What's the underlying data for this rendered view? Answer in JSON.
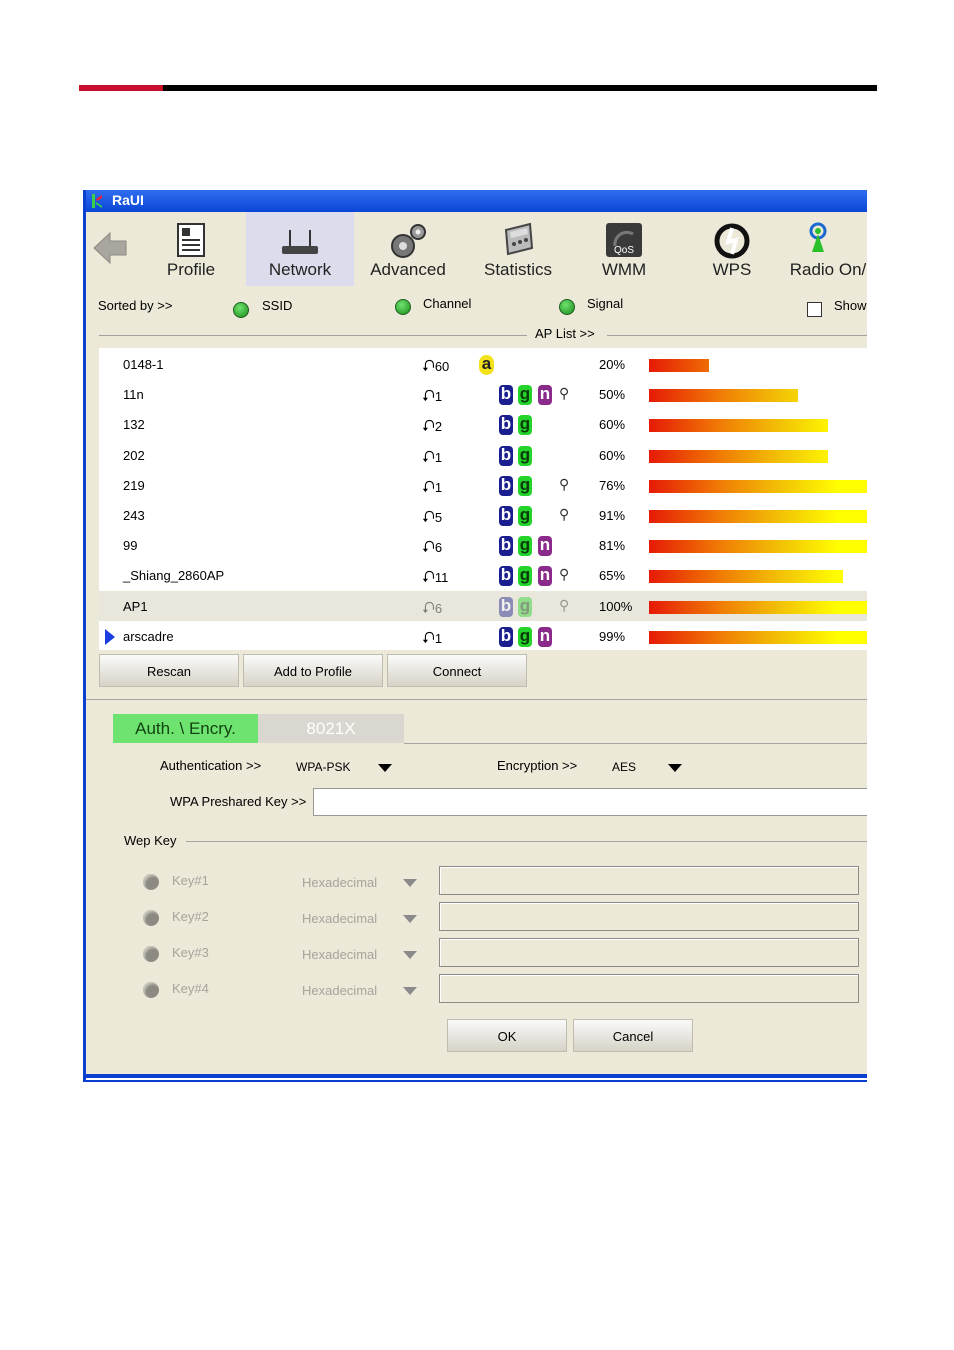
{
  "app": {
    "title": "RaUI"
  },
  "toolbar": {
    "items": [
      {
        "label": "Profile"
      },
      {
        "label": "Network"
      },
      {
        "label": "Advanced"
      },
      {
        "label": "Statistics"
      },
      {
        "label": "WMM"
      },
      {
        "label": "WPS"
      },
      {
        "label": "Radio On/"
      }
    ],
    "active": "Network"
  },
  "sort": {
    "label": "Sorted by >>",
    "options": [
      "SSID",
      "Channel",
      "Signal"
    ],
    "show_label": "Show"
  },
  "aplist": {
    "label": "AP List >>",
    "rows": [
      {
        "ssid": "0148-1",
        "channel": "60",
        "modes": [
          "a"
        ],
        "secured": false,
        "signal": "20%",
        "signal_value": 20
      },
      {
        "ssid": "11n",
        "channel": "1",
        "modes": [
          "b",
          "g",
          "n"
        ],
        "secured": true,
        "signal": "50%",
        "signal_value": 50
      },
      {
        "ssid": "132",
        "channel": "2",
        "modes": [
          "b",
          "g"
        ],
        "secured": false,
        "signal": "60%",
        "signal_value": 60
      },
      {
        "ssid": "202",
        "channel": "1",
        "modes": [
          "b",
          "g"
        ],
        "secured": false,
        "signal": "60%",
        "signal_value": 60
      },
      {
        "ssid": "219",
        "channel": "1",
        "modes": [
          "b",
          "g"
        ],
        "secured": true,
        "signal": "76%",
        "signal_value": 76
      },
      {
        "ssid": "243",
        "channel": "5",
        "modes": [
          "b",
          "g"
        ],
        "secured": true,
        "signal": "91%",
        "signal_value": 91
      },
      {
        "ssid": "99",
        "channel": "6",
        "modes": [
          "b",
          "g",
          "n"
        ],
        "secured": false,
        "signal": "81%",
        "signal_value": 81
      },
      {
        "ssid": "_Shiang_2860AP",
        "channel": "11",
        "modes": [
          "b",
          "g",
          "n"
        ],
        "secured": true,
        "signal": "65%",
        "signal_value": 65
      },
      {
        "ssid": "AP1",
        "channel": "6",
        "modes": [
          "b",
          "g"
        ],
        "secured": true,
        "signal": "100%",
        "signal_value": 100
      },
      {
        "ssid": "arscadre",
        "channel": "1",
        "modes": [
          "b",
          "g",
          "n"
        ],
        "secured": false,
        "signal": "99%",
        "signal_value": 99
      }
    ]
  },
  "buttons": {
    "rescan": "Rescan",
    "add_to_profile": "Add to Profile",
    "connect": "Connect",
    "ok": "OK",
    "cancel": "Cancel"
  },
  "tabs": [
    "Auth. \\ Encry.",
    "8021X"
  ],
  "security": {
    "auth_label": "Authentication >>",
    "auth_value": "WPA-PSK",
    "enc_label": "Encryption >>",
    "enc_value": "AES",
    "psk_label": "WPA Preshared Key >>",
    "psk_value": ""
  },
  "wep": {
    "label": "Wep Key",
    "keys": [
      {
        "label": "Key#1",
        "format": "Hexadecimal"
      },
      {
        "label": "Key#2",
        "format": "Hexadecimal"
      },
      {
        "label": "Key#3",
        "format": "Hexadecimal"
      },
      {
        "label": "Key#4",
        "format": "Hexadecimal"
      }
    ]
  }
}
